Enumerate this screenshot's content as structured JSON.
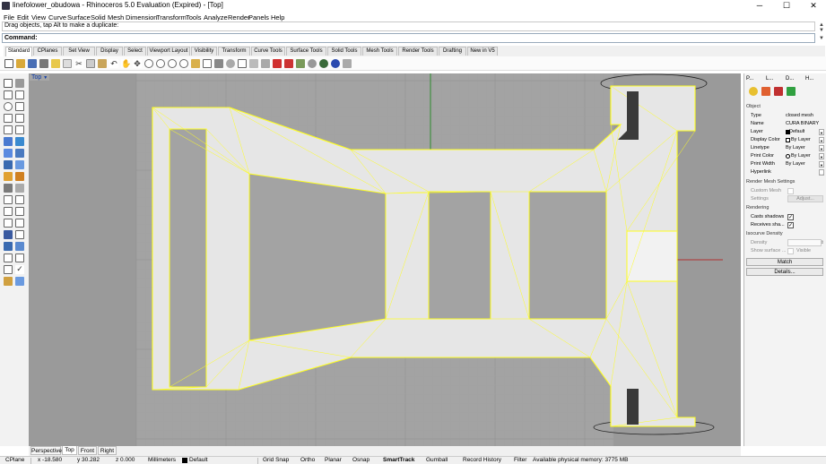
{
  "window": {
    "title": "linefolower_obudowa - Rhinoceros 5.0 Evaluation (Expired) - [Top]",
    "minimize": "─",
    "maximize": "☐",
    "close": "✕"
  },
  "menu": [
    "File",
    "Edit",
    "View",
    "Curve",
    "Surface",
    "Solid",
    "Mesh",
    "Dimension",
    "Transform",
    "Tools",
    "Analyze",
    "Render",
    "Panels",
    "Help"
  ],
  "command": {
    "history": "Drag objects, tap Alt to make a duplicate:",
    "prompt": "Command:"
  },
  "tabs": [
    "Standard",
    "CPlanes",
    "Set View",
    "Display",
    "Select",
    "Viewport Layout",
    "Visibility",
    "Transform",
    "Curve Tools",
    "Surface Tools",
    "Solid Tools",
    "Mesh Tools",
    "Render Tools",
    "Drafting",
    "New in V5"
  ],
  "viewport": {
    "label": "Top",
    "tabs": [
      "Perspective",
      "Top",
      "Front",
      "Right"
    ],
    "active_tab": "Top"
  },
  "panel": {
    "tabs": [
      "P...",
      "L...",
      "D...",
      "H..."
    ],
    "object_section": "Object",
    "rows": [
      {
        "label": "Type",
        "value": "closed mesh"
      },
      {
        "label": "Name",
        "value": "CURA BINARY"
      },
      {
        "label": "Layer",
        "value": "Default"
      },
      {
        "label": "Display Color",
        "value": "By Layer"
      },
      {
        "label": "Linetype",
        "value": "By Layer"
      },
      {
        "label": "Print Color",
        "value": "By Layer"
      },
      {
        "label": "Print Width",
        "value": "By Layer"
      },
      {
        "label": "Hyperlink",
        "value": ""
      }
    ],
    "render_mesh_section": "Render Mesh Settings",
    "custom_mesh": "Custom Mesh",
    "settings": "Settings",
    "adjust": "Adjust...",
    "rendering_section": "Rendering",
    "casts_shadows": "Casts shadows",
    "receives_shadows": "Receives sha...",
    "isocurve_section": "Isocurve Density",
    "density": "Density",
    "show_surface": "Show surface ...",
    "visible": "Visible",
    "match_button": "Match",
    "details_button": "Details..."
  },
  "status": {
    "cplane": "CPlane",
    "x": "x -18.580",
    "y": "y 30.282",
    "z": "z 0.000",
    "units": "Millimeters",
    "layer": "Default",
    "grid_snap": "Grid Snap",
    "ortho": "Ortho",
    "planar": "Planar",
    "osnap": "Osnap",
    "smarttrack": "SmartTrack",
    "gumball": "Gumball",
    "record_history": "Record History",
    "filter": "Filter",
    "memory": "Available physical memory: 3775 MB"
  },
  "colors": {
    "viewport_bg": "#9a9a9a",
    "mesh_fill": "#e6e6e6",
    "mesh_edge": "#ffff20",
    "x_axis": "#b03030",
    "y_axis": "#2e8b2e",
    "grid_minor": "#a2a2a2",
    "grid_major": "#8e8e8e"
  }
}
